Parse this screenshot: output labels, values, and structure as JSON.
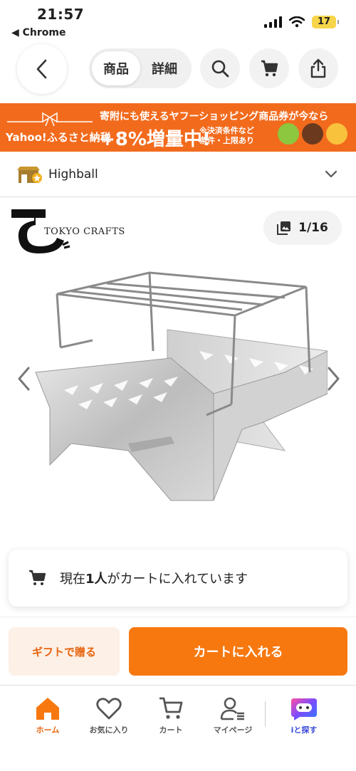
{
  "status_bar": {
    "time": "21:57",
    "back_app": "◀ Chrome",
    "battery": "17"
  },
  "nav": {
    "tabs": [
      {
        "label": "商品",
        "active": true
      },
      {
        "label": "詳細",
        "active": false
      }
    ]
  },
  "banner": {
    "line1": "寄附にも使えるヤフーショッピング商品券が今なら",
    "brand": "Yahoo!ふるさと納税",
    "percent": "+8%増量中!",
    "condition_line1": "※決済条件など",
    "condition_line2": "条件・上限あり"
  },
  "store": {
    "name": "Highball"
  },
  "product": {
    "logo_text": "TOKYO CRAFTS",
    "image_counter": "1/16"
  },
  "notice": {
    "prefix": "現在",
    "count": "1人",
    "suffix": "がカートに入れています"
  },
  "actions": {
    "gift_label": "ギフトで贈る",
    "cart_label": "カートに入れる"
  },
  "tabbar": {
    "items": [
      {
        "label": "ホーム",
        "icon": "home-icon",
        "active": true
      },
      {
        "label": "お気に入り",
        "icon": "heart-icon",
        "active": false
      },
      {
        "label": "カート",
        "icon": "cart-icon",
        "active": false
      },
      {
        "label": "マイページ",
        "icon": "user-icon",
        "active": false
      },
      {
        "label": "iと探す",
        "icon": "assistant-icon",
        "active": false
      }
    ]
  },
  "colors": {
    "accent": "#f7780f",
    "banner": "#f26b1d"
  }
}
